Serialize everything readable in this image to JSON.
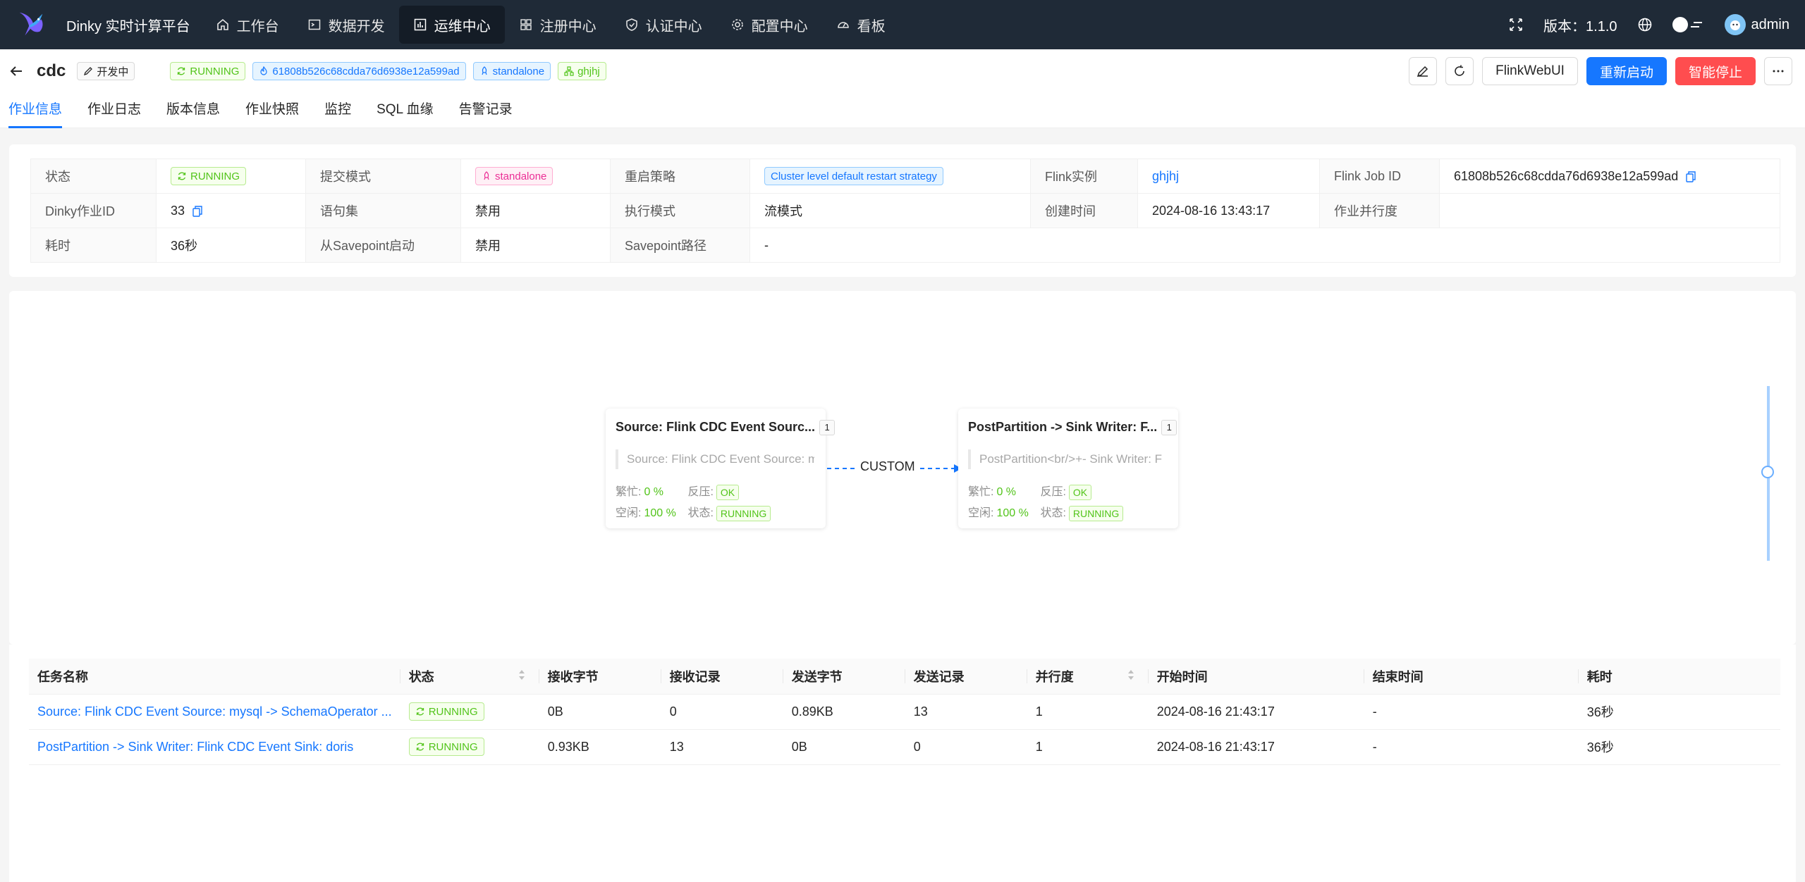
{
  "app": {
    "title": "Dinky 实时计算平台",
    "nav": [
      {
        "label": "工作台",
        "icon": "home-icon"
      },
      {
        "label": "数据开发",
        "icon": "terminal-icon"
      },
      {
        "label": "运维中心",
        "icon": "dashboard-icon",
        "active": true
      },
      {
        "label": "注册中心",
        "icon": "appstore-icon"
      },
      {
        "label": "认证中心",
        "icon": "shield-icon"
      },
      {
        "label": "配置中心",
        "icon": "gear-icon"
      },
      {
        "label": "看板",
        "icon": "gauge-icon"
      }
    ],
    "version_label": "版本：1.1.0",
    "user": "admin"
  },
  "job": {
    "name": "cdc",
    "dev_tag": "开发中",
    "status": "RUNNING",
    "job_id": "61808b526c68cdda76d6938e12a599ad",
    "mode": "standalone",
    "cluster": "ghjhj"
  },
  "actions": {
    "flink_web_ui": "FlinkWebUI",
    "restart": "重新启动",
    "smart_stop": "智能停止"
  },
  "tabs": [
    "作业信息",
    "作业日志",
    "版本信息",
    "作业快照",
    "监控",
    "SQL 血缘",
    "告警记录"
  ],
  "info": {
    "status_label": "状态",
    "status_value": "RUNNING",
    "submit_mode_label": "提交模式",
    "submit_mode_value": "standalone",
    "restart_label": "重启策略",
    "restart_value": "Cluster level default restart strategy",
    "flink_instance_label": "Flink实例",
    "flink_instance_value": "ghjhj",
    "flink_job_id_label": "Flink Job ID",
    "flink_job_id_value": "61808b526c68cdda76d6938e12a599ad",
    "dinky_job_id_label": "Dinky作业ID",
    "dinky_job_id_value": "33",
    "statement_set_label": "语句集",
    "statement_set_value": "禁用",
    "exec_mode_label": "执行模式",
    "exec_mode_value": "流模式",
    "create_time_label": "创建时间",
    "create_time_value": "2024-08-16 13:43:17",
    "parallelism_label": "作业并行度",
    "parallelism_value": "",
    "duration_label": "耗时",
    "duration_value": "36秒",
    "from_savepoint_label": "从Savepoint启动",
    "from_savepoint_value": "禁用",
    "savepoint_path_label": "Savepoint路径",
    "savepoint_path_value": "-"
  },
  "graph": {
    "nodes": [
      {
        "title": "Source: Flink CDC Event Sourc...",
        "parallelism": "1",
        "desc": "Source: Flink CDC Event Source: mysql",
        "busy_label": "繁忙:",
        "busy": "0 %",
        "backpressure_label": "反压:",
        "backpressure": "OK",
        "idle_label": "空闲:",
        "idle": "100 %",
        "state_label": "状态:",
        "state": "RUNNING"
      },
      {
        "title": "PostPartition -> Sink Writer: F...",
        "parallelism": "1",
        "desc": "PostPartition<br/>+- Sink Writer: F",
        "busy_label": "繁忙:",
        "busy": "0 %",
        "backpressure_label": "反压:",
        "backpressure": "OK",
        "idle_label": "空闲:",
        "idle": "100 %",
        "state_label": "状态:",
        "state": "RUNNING"
      }
    ],
    "edge_label": "CUSTOM"
  },
  "tasks": {
    "columns": [
      "任务名称",
      "状态",
      "接收字节",
      "接收记录",
      "发送字节",
      "发送记录",
      "并行度",
      "开始时间",
      "结束时间",
      "耗时"
    ],
    "rows": [
      {
        "name": "Source: Flink CDC Event Source: mysql -> SchemaOperator ...",
        "status": "RUNNING",
        "recv_bytes": "0B",
        "recv_records": "0",
        "send_bytes": "0.89KB",
        "send_records": "13",
        "parallelism": "1",
        "start": "2024-08-16 21:43:17",
        "end": "-",
        "duration": "36秒"
      },
      {
        "name": "PostPartition -> Sink Writer: Flink CDC Event Sink: doris",
        "status": "RUNNING",
        "recv_bytes": "0.93KB",
        "recv_records": "13",
        "send_bytes": "0B",
        "send_records": "0",
        "parallelism": "1",
        "start": "2024-08-16 21:43:17",
        "end": "-",
        "duration": "36秒"
      }
    ]
  },
  "colors": {
    "nav_bg": "#1f2a37",
    "primary": "#1677ff",
    "danger": "#ff4d4f",
    "success": "#52c41a"
  }
}
